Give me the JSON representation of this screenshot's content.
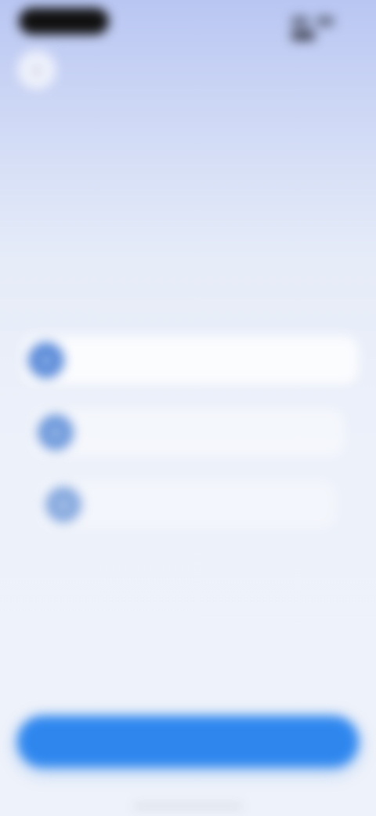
{
  "status_bar": {
    "time": ""
  },
  "header": {
    "back_icon": "chevron-left-icon",
    "label": "",
    "headline": "",
    "subheadline": ""
  },
  "steps": [
    {
      "icon": "step-icon",
      "title": "",
      "description": "",
      "meta": ""
    },
    {
      "icon": "step-icon",
      "title": "",
      "description": "",
      "meta": ""
    },
    {
      "icon": "step-icon",
      "title": "",
      "description": "",
      "meta": ""
    }
  ],
  "footer": {
    "note": "",
    "primary_button_label": ""
  },
  "colors": {
    "primary": "#2F87EE",
    "step_icon": "#5B8BD9",
    "background_top": "#B9C6F2",
    "background_bottom": "#EEF2FA"
  }
}
